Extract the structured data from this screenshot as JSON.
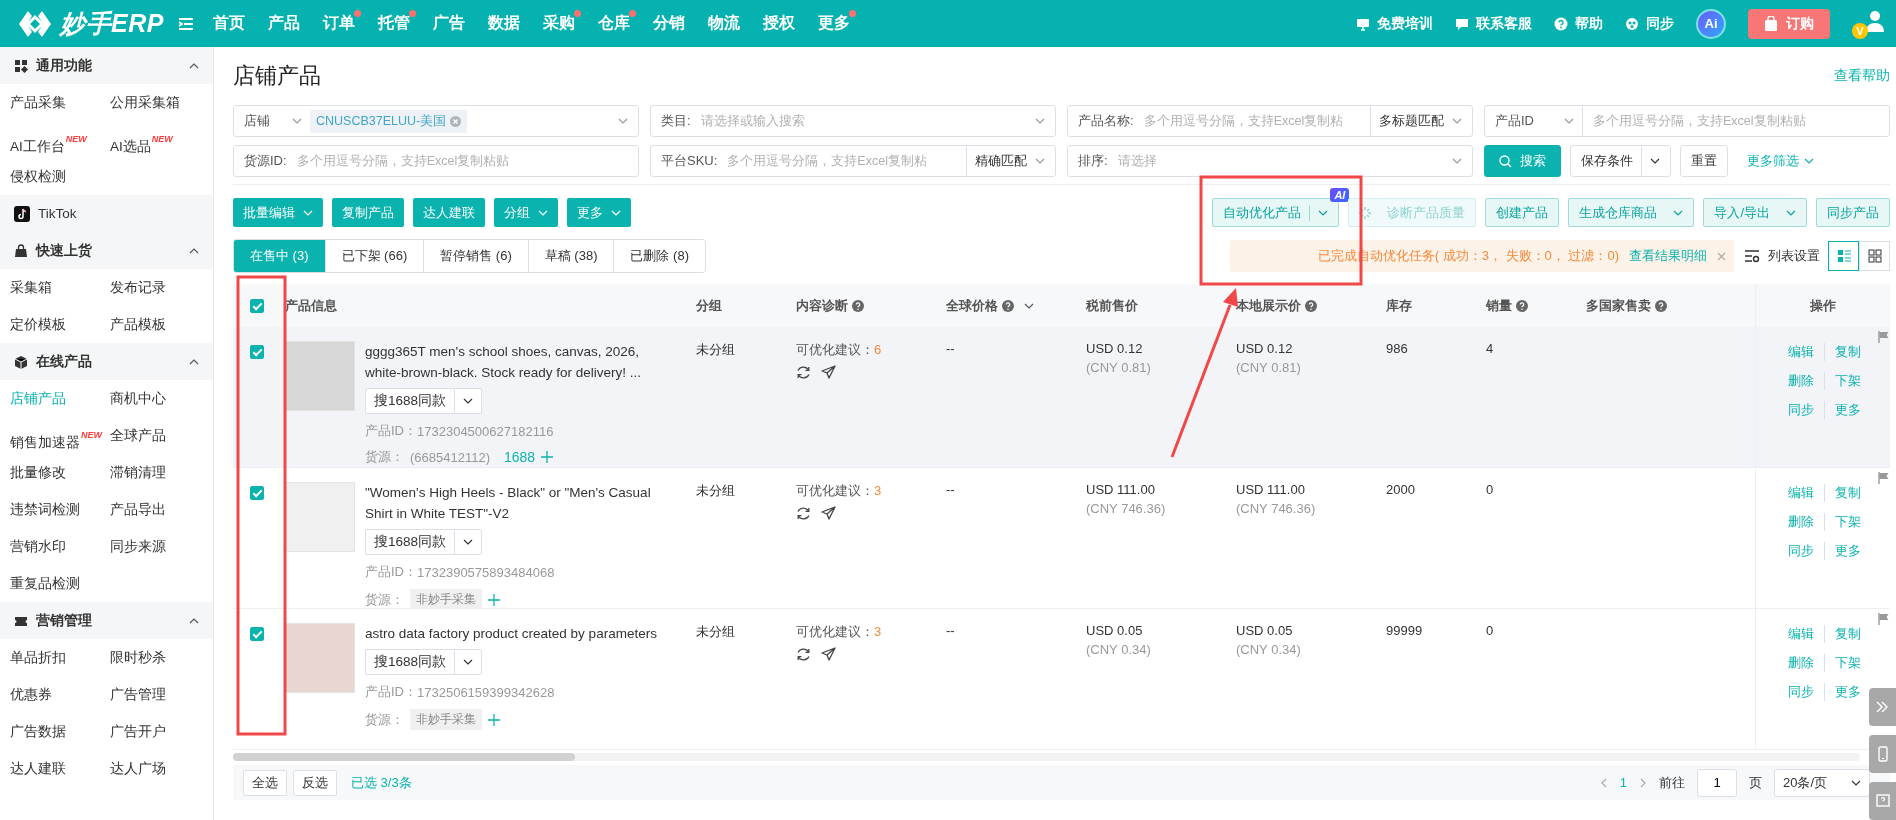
{
  "topbar": {
    "logo": "妙手ERP",
    "nav": [
      {
        "label": "首页",
        "badge": false
      },
      {
        "label": "产品",
        "badge": false
      },
      {
        "label": "订单",
        "badge": true
      },
      {
        "label": "托管",
        "badge": true
      },
      {
        "label": "广告",
        "badge": false
      },
      {
        "label": "数据",
        "badge": false
      },
      {
        "label": "采购",
        "badge": true
      },
      {
        "label": "仓库",
        "badge": true
      },
      {
        "label": "分销",
        "badge": false
      },
      {
        "label": "物流",
        "badge": false
      },
      {
        "label": "授权",
        "badge": false
      },
      {
        "label": "更多",
        "badge": true
      }
    ],
    "links": [
      {
        "kind": "training",
        "label": "免费培训"
      },
      {
        "kind": "service",
        "label": "联系客服"
      },
      {
        "kind": "help",
        "label": "帮助"
      },
      {
        "kind": "sync",
        "label": "同步"
      }
    ],
    "ai_badge": "Ai",
    "order_button": "订购",
    "avatar_badge": "V"
  },
  "sidebar": {
    "sections": [
      {
        "kind": "group",
        "title": "通用功能",
        "expanded": true,
        "items": [
          {
            "label": "产品采集",
            "selected": false
          },
          {
            "label": "公用采集箱",
            "selected": false
          },
          {
            "label": "AI工作台",
            "badge": "NEW",
            "selected": false
          },
          {
            "label": "AI选品",
            "badge": "NEW",
            "selected": false
          },
          {
            "label": "侵权检测",
            "selected": false
          }
        ]
      },
      {
        "kind": "platform",
        "title": "TikTok"
      },
      {
        "kind": "group",
        "title": "快速上货",
        "expanded": true,
        "items": [
          {
            "label": "采集箱",
            "selected": false
          },
          {
            "label": "发布记录",
            "selected": false
          },
          {
            "label": "定价模板",
            "selected": false
          },
          {
            "label": "产品模板",
            "selected": false
          }
        ]
      },
      {
        "kind": "group",
        "title": "在线产品",
        "expanded": true,
        "items": [
          {
            "label": "店铺产品",
            "selected": true
          },
          {
            "label": "商机中心",
            "selected": false
          },
          {
            "label": "销售加速器",
            "badge": "NEW",
            "selected": false
          },
          {
            "label": "全球产品",
            "selected": false
          },
          {
            "label": "批量修改",
            "selected": false
          },
          {
            "label": "滞销清理",
            "selected": false
          },
          {
            "label": "违禁词检测",
            "selected": false
          },
          {
            "label": "产品导出",
            "selected": false
          },
          {
            "label": "营销水印",
            "selected": false
          },
          {
            "label": "同步来源",
            "selected": false
          },
          {
            "label": "重复品检测",
            "selected": false
          }
        ]
      },
      {
        "kind": "group",
        "title": "营销管理",
        "expanded": true,
        "items": [
          {
            "label": "单品折扣",
            "selected": false
          },
          {
            "label": "限时秒杀",
            "selected": false
          },
          {
            "label": "优惠券",
            "selected": false
          },
          {
            "label": "广告管理",
            "selected": false
          },
          {
            "label": "广告数据",
            "selected": false
          },
          {
            "label": "广告开户",
            "selected": false
          },
          {
            "label": "达人建联",
            "selected": false
          },
          {
            "label": "达人广场",
            "selected": false
          }
        ]
      }
    ]
  },
  "page": {
    "title": "店铺产品",
    "help_link": "查看帮助"
  },
  "filters": {
    "store": {
      "label": "店铺",
      "tag": "CNUSCB37ELUU-美国"
    },
    "category": {
      "label": "类目:",
      "placeholder": "请选择或输入搜索"
    },
    "product_name": {
      "label": "产品名称:",
      "placeholder": "多个用逗号分隔，支持Excel复制粘",
      "match": "多标题匹配"
    },
    "product_id": {
      "label": "产品ID",
      "placeholder": "多个用逗号分隔，支持Excel复制粘贴"
    },
    "source_id": {
      "label": "货源ID:",
      "placeholder": "多个用逗号分隔，支持Excel复制粘贴"
    },
    "platform_sku": {
      "label": "平台SKU:",
      "placeholder": "多个用逗号分隔，支持Excel复制粘",
      "match": "精确匹配"
    },
    "sort": {
      "label": "排序:",
      "placeholder": "请选择"
    },
    "search_button": "搜索",
    "save_button": "保存条件",
    "reset_button": "重置",
    "more_filters": "更多筛选"
  },
  "toolbar": {
    "left": [
      {
        "label": "批量编辑",
        "dropdown": true
      },
      {
        "label": "复制产品",
        "dropdown": false
      },
      {
        "label": "达人建联",
        "dropdown": false
      },
      {
        "label": "分组",
        "dropdown": true
      },
      {
        "label": "更多",
        "dropdown": true
      }
    ],
    "right": [
      {
        "kind": "split",
        "label": "自动优化产品",
        "ai_badge": "AI"
      },
      {
        "kind": "loading",
        "label": "诊断产品质量"
      },
      {
        "kind": "plain",
        "label": "创建产品"
      },
      {
        "kind": "dropdown",
        "label": "生成仓库商品"
      },
      {
        "kind": "dropdown",
        "label": "导入/导出"
      },
      {
        "kind": "plain",
        "label": "同步产品"
      }
    ]
  },
  "tabs": [
    {
      "label": "在售中 (3)",
      "selected": true
    },
    {
      "label": "已下架 (66)",
      "selected": false
    },
    {
      "label": "暂停销售 (6)",
      "selected": false
    },
    {
      "label": "草稿 (38)",
      "selected": false
    },
    {
      "label": "已删除 (8)",
      "selected": false
    }
  ],
  "notice": {
    "text": "已完成自动优化任务( 成功：3， 失败：0， 过滤：0)",
    "link": "查看结果明细"
  },
  "list_settings": "列表设置",
  "views": [
    {
      "kind": "list",
      "selected": true
    },
    {
      "kind": "grid",
      "selected": false
    }
  ],
  "table": {
    "all_selected": true,
    "columns": [
      {
        "label": "产品信息",
        "help": false,
        "sort": false
      },
      {
        "label": "分组",
        "help": false,
        "sort": false
      },
      {
        "label": "内容诊断",
        "help": true,
        "sort": false
      },
      {
        "label": "全球价格",
        "help": true,
        "sort": true
      },
      {
        "label": "税前售价",
        "help": false,
        "sort": false
      },
      {
        "label": "本地展示价",
        "help": true,
        "sort": false
      },
      {
        "label": "库存",
        "help": false,
        "sort": false
      },
      {
        "label": "销量",
        "help": true,
        "sort": false
      },
      {
        "label": "多国家售卖",
        "help": true,
        "sort": false
      },
      {
        "label": "操作",
        "help": false,
        "sort": false
      }
    ],
    "rows": [
      {
        "selected": true,
        "highlighted": true,
        "title": "gggg365T men's school shoes, canvas, 2026, white-brown-black. Stock ready for delivery! ...",
        "search_button": "搜1688同款",
        "id_label": "产品ID：",
        "product_id": "1732304500627182116",
        "source_label": "货源：",
        "source": {
          "kind": "id",
          "text": "(6685412112)",
          "link": "1688"
        },
        "group": "未分组",
        "diagnosis_label": "可优化建议：",
        "diagnosis_count": "6",
        "global_price": "--",
        "pretax_price": "USD 0.12",
        "pretax_cny": "(CNY 0.81)",
        "local_price": "USD 0.12",
        "local_cny": "(CNY 0.81)",
        "stock": "986",
        "sales": "4",
        "actions": [
          "编辑",
          "复制",
          "删除",
          "下架",
          "同步",
          "更多"
        ]
      },
      {
        "selected": true,
        "highlighted": false,
        "title": "\"Women's High Heels - Black\" or \"Men's Casual Shirt in White TEST\"-V2",
        "search_button": "搜1688同款",
        "id_label": "产品ID：",
        "product_id": "1732390575893484068",
        "source_label": "货源：",
        "source": {
          "kind": "tag",
          "text": "非妙手采集"
        },
        "group": "未分组",
        "diagnosis_label": "可优化建议：",
        "diagnosis_count": "3",
        "global_price": "--",
        "pretax_price": "USD 111.00",
        "pretax_cny": "(CNY 746.36)",
        "local_price": "USD 111.00",
        "local_cny": "(CNY 746.36)",
        "stock": "2000",
        "sales": "0",
        "actions": [
          "编辑",
          "复制",
          "删除",
          "下架",
          "同步",
          "更多"
        ]
      },
      {
        "selected": true,
        "highlighted": false,
        "title": "astro data factory product created by parameters",
        "search_button": "搜1688同款",
        "id_label": "产品ID：",
        "product_id": "1732506159399342628",
        "source_label": "货源：",
        "source": {
          "kind": "tag",
          "text": "非妙手采集"
        },
        "group": "未分组",
        "diagnosis_label": "可优化建议：",
        "diagnosis_count": "3",
        "global_price": "--",
        "pretax_price": "USD 0.05",
        "pretax_cny": "(CNY 0.34)",
        "local_price": "USD 0.05",
        "local_cny": "(CNY 0.34)",
        "stock": "99999",
        "sales": "0",
        "actions": [
          "编辑",
          "复制",
          "删除",
          "下架",
          "同步",
          "更多"
        ]
      }
    ]
  },
  "footer": {
    "select_all": "全选",
    "invert": "反选",
    "selected_count": "已选 3/3条",
    "page": "1",
    "goto_label": "前往",
    "goto_value": "1",
    "page_unit": "页",
    "page_size": "20条/页"
  }
}
